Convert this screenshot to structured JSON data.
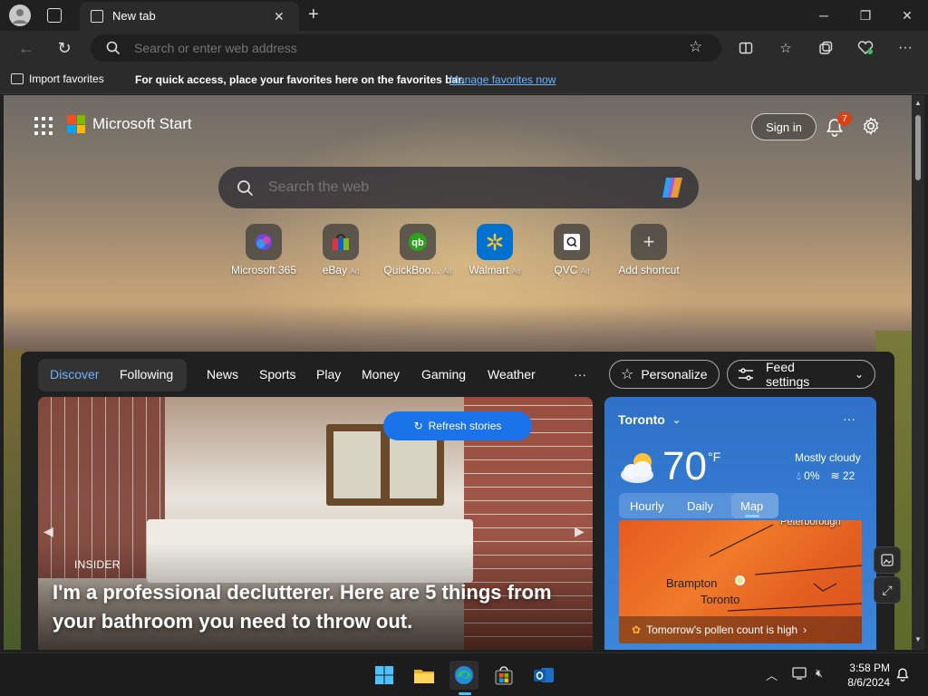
{
  "browser": {
    "tab_title": "New tab",
    "address_placeholder": "Search or enter web address"
  },
  "favorites_bar": {
    "import_label": "Import favorites",
    "prompt_text": "For quick access, place your favorites here on the favorites bar.",
    "manage_link": "Manage favorites now"
  },
  "start": {
    "brand": "Microsoft Start",
    "sign_in": "Sign in",
    "notification_count": "7",
    "search_placeholder": "Search the web",
    "shortcuts": [
      {
        "name": "Microsoft 365",
        "ad": "",
        "icon": "microsoft-365-icon"
      },
      {
        "name": "eBay",
        "ad": "Ad",
        "icon": "ebay-icon"
      },
      {
        "name": "QuickBoo...",
        "ad": "Ad",
        "icon": "quickbooks-icon"
      },
      {
        "name": "Walmart",
        "ad": "Ad",
        "icon": "walmart-icon"
      },
      {
        "name": "QVC",
        "ad": "Ad",
        "icon": "qvc-icon"
      },
      {
        "name": "Add shortcut",
        "ad": "",
        "icon": "plus-icon"
      }
    ]
  },
  "feed": {
    "toggle": {
      "discover": "Discover",
      "following": "Following"
    },
    "tabs": [
      "News",
      "Sports",
      "Play",
      "Money",
      "Gaming",
      "Weather"
    ],
    "more": "···",
    "personalize": "Personalize",
    "feed_settings": "Feed settings",
    "refresh_stories": "Refresh stories",
    "hero": {
      "source": "INSIDER",
      "title": "I'm a professional declutterer. Here are 5 things from your bathroom you need to throw out."
    }
  },
  "weather": {
    "city": "Toronto",
    "temperature": "70",
    "unit": "°F",
    "condition": "Mostly cloudy",
    "precip": "0%",
    "wind": "22",
    "more": "···",
    "tabs": [
      "Hourly",
      "Daily",
      "Map"
    ],
    "active_tab": "Map",
    "map_labels": {
      "peterborough": "Peterborough",
      "brampton": "Brampton",
      "toronto": "Toronto"
    },
    "pollen": "Tomorrow's pollen count is high"
  },
  "taskbar": {
    "time": "3:58 PM",
    "date": "8/6/2024"
  },
  "colors": {
    "accent_blue": "#1a73e8",
    "link_blue": "#6cb4ff",
    "badge_orange": "#d84315"
  }
}
